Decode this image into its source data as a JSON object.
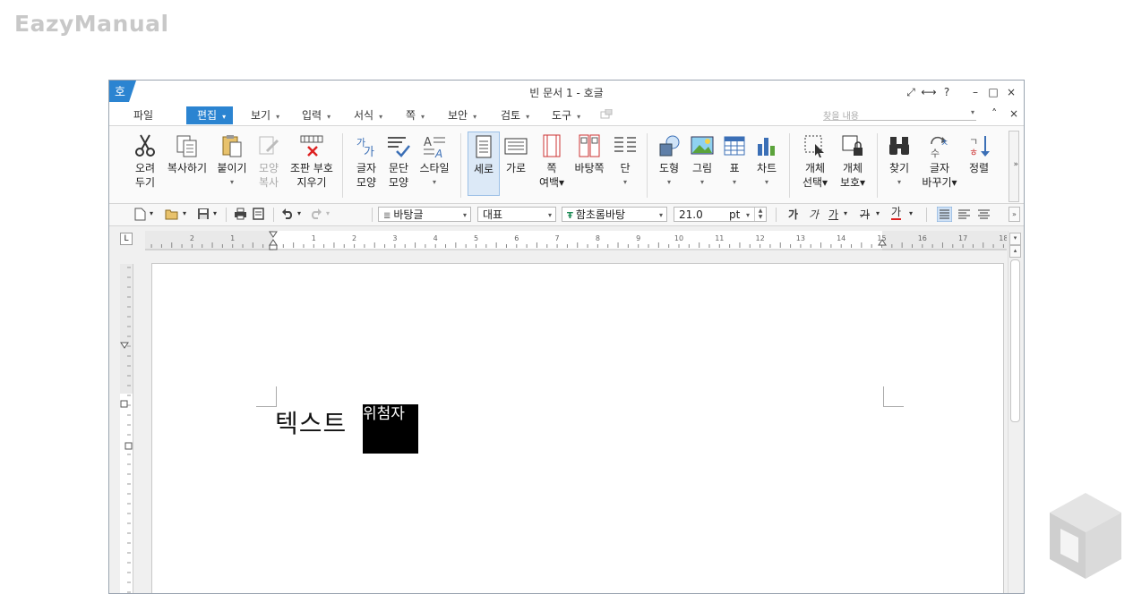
{
  "watermark": "EazyManual",
  "window": {
    "title": "빈 문서 1 - 호글",
    "app_logo": "호",
    "title_buttons": [
      "⤢",
      "⟷",
      "?",
      "–",
      "□",
      "×"
    ]
  },
  "menubar": {
    "items": [
      {
        "label": "파일",
        "arrow": ""
      },
      {
        "label": "편집",
        "arrow": "▾"
      },
      {
        "label": "보기",
        "arrow": "▾"
      },
      {
        "label": "입력",
        "arrow": "▾"
      },
      {
        "label": "서식",
        "arrow": "▾"
      },
      {
        "label": "쪽",
        "arrow": "▾"
      },
      {
        "label": "보안",
        "arrow": "▾"
      },
      {
        "label": "검토",
        "arrow": "▾"
      },
      {
        "label": "도구",
        "arrow": "▾"
      }
    ],
    "find_placeholder": "찾을 내용",
    "right_buttons": [
      "▾",
      "˄",
      "×"
    ]
  },
  "ribbon": {
    "buttons": [
      {
        "line1": "오려",
        "line2": "두기",
        "icon": "scissors-icon"
      },
      {
        "line1": "복사하기",
        "line2": "",
        "icon": "copy-icon"
      },
      {
        "line1": "붙이기",
        "line2": "▾",
        "icon": "paste-icon"
      },
      {
        "line1": "모양",
        "line2": "복사",
        "icon": "format-painter-icon"
      },
      {
        "line1": "조판 부호",
        "line2": "지우기",
        "icon": "clear-code-icon"
      },
      {
        "line1": "글자",
        "line2": "모양",
        "icon": "char-shape-icon"
      },
      {
        "line1": "문단",
        "line2": "모양",
        "icon": "para-shape-icon"
      },
      {
        "line1": "스타일",
        "line2": "▾",
        "icon": "style-icon"
      },
      {
        "line1": "세로",
        "line2": "",
        "icon": "portrait-icon"
      },
      {
        "line1": "가로",
        "line2": "",
        "icon": "landscape-icon"
      },
      {
        "line1": "쪽",
        "line2": "여백▾",
        "icon": "margin-icon"
      },
      {
        "line1": "바탕쪽",
        "line2": "",
        "icon": "master-page-icon"
      },
      {
        "line1": "단",
        "line2": "▾",
        "icon": "columns-icon"
      },
      {
        "line1": "도형",
        "line2": "▾",
        "icon": "shape-icon"
      },
      {
        "line1": "그림",
        "line2": "▾",
        "icon": "picture-icon"
      },
      {
        "line1": "표",
        "line2": "▾",
        "icon": "table-icon"
      },
      {
        "line1": "차트",
        "line2": "▾",
        "icon": "chart-icon"
      },
      {
        "line1": "개체",
        "line2": "선택▾",
        "icon": "select-object-icon"
      },
      {
        "line1": "개체",
        "line2": "보호▾",
        "icon": "protect-object-icon"
      },
      {
        "line1": "찾기",
        "line2": "▾",
        "icon": "find-icon"
      },
      {
        "line1": "글자",
        "line2": "바꾸기▾",
        "icon": "char-replace-icon"
      },
      {
        "line1": "정렬",
        "line2": "",
        "icon": "sort-icon"
      }
    ],
    "more": "»"
  },
  "toolbar": {
    "style_combo": "바탕글",
    "lang_combo": "대표",
    "font_combo": "함초롬바탕",
    "size_value": "21.0",
    "size_unit": "pt",
    "bold": "가",
    "italic": "가",
    "underline": "가",
    "strike": "가",
    "color": "가"
  },
  "ruler": {
    "h_ticks": [
      "2",
      "1",
      "1",
      "2",
      "3",
      "4",
      "5",
      "6",
      "7",
      "8",
      "9",
      "10",
      "11",
      "12",
      "13",
      "14",
      "15",
      "16",
      "17",
      "18"
    ],
    "corner": "L"
  },
  "document": {
    "text": "텍스트",
    "placeholder": "위첨자"
  }
}
